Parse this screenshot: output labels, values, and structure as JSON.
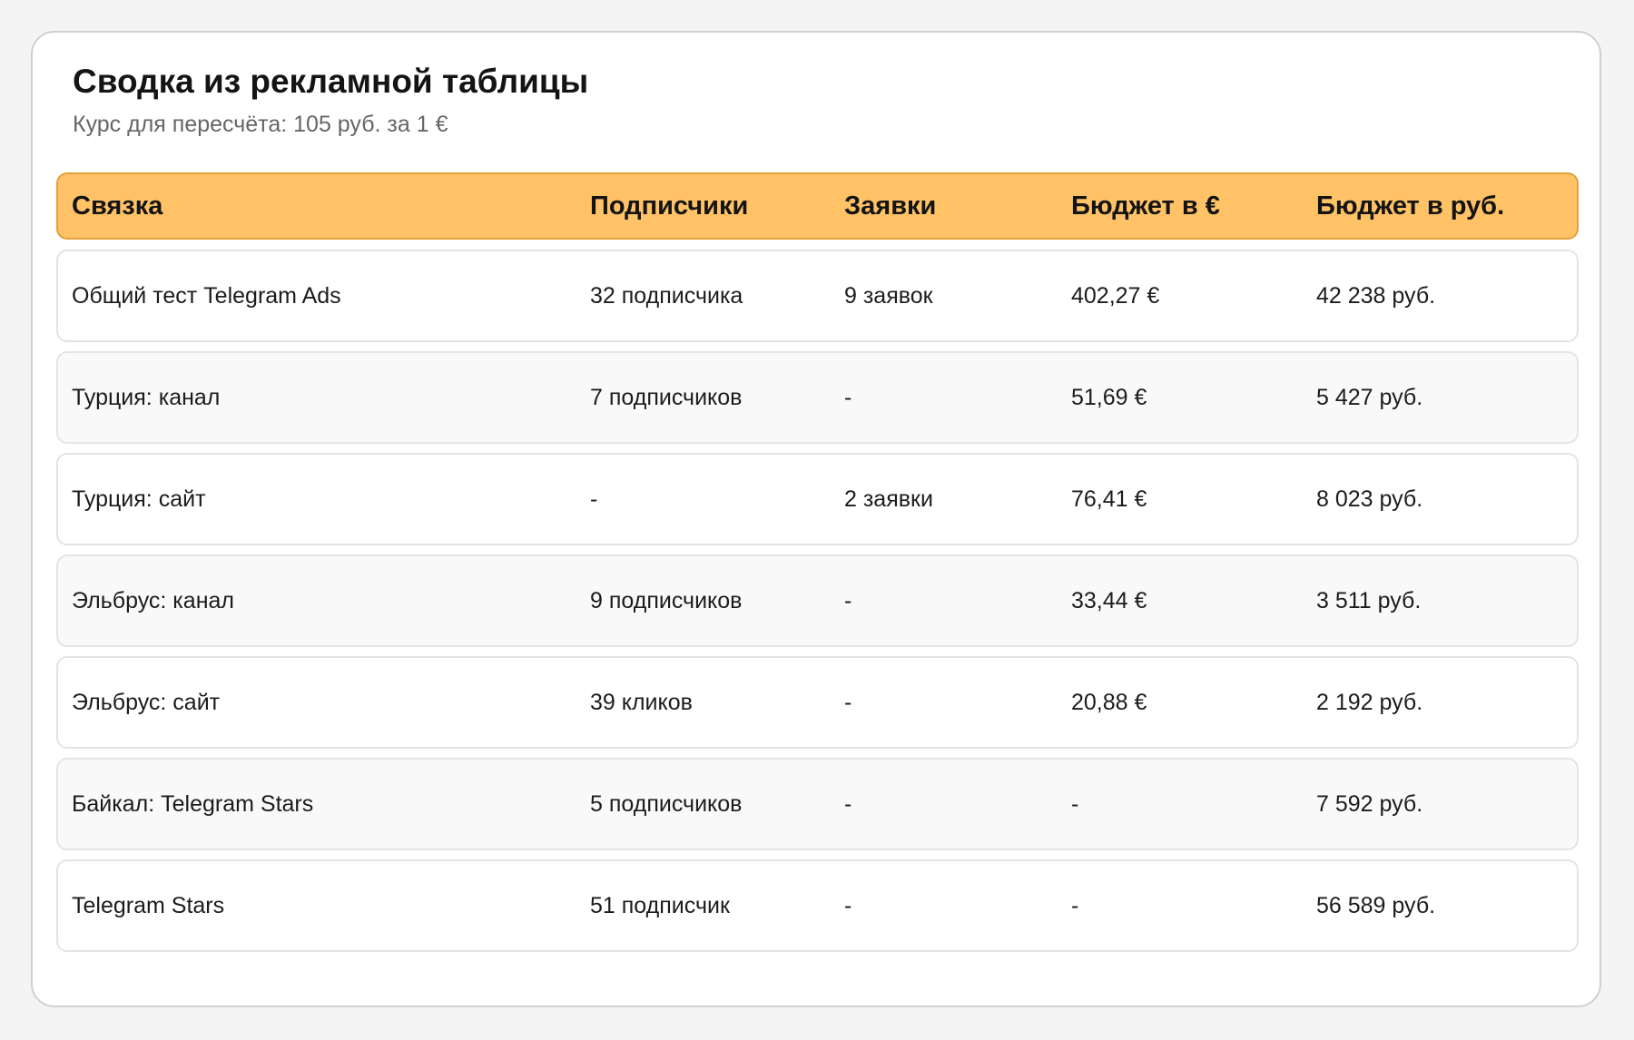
{
  "title": "Сводка из рекламной таблицы",
  "subtitle": "Курс для пересчёта: 105 руб. за 1 €",
  "table": {
    "headers": [
      "Связка",
      "Подписчики",
      "Заявки",
      "Бюджет в €",
      "Бюджет в руб."
    ],
    "rows": [
      [
        "Общий тест Telegram Ads",
        "32 подписчика",
        "9 заявок",
        "402,27 €",
        "42 238 руб."
      ],
      [
        "Турция: канал",
        "7 подписчиков",
        "-",
        "51,69 €",
        "5 427 руб."
      ],
      [
        "Турция: сайт",
        "-",
        "2 заявки",
        "76,41 €",
        "8 023 руб."
      ],
      [
        "Эльбрус: канал",
        "9 подписчиков",
        "-",
        "33,44 €",
        "3 511 руб."
      ],
      [
        "Эльбрус: сайт",
        "39 кликов",
        "-",
        "20,88 €",
        "2 192 руб."
      ],
      [
        "Байкал: Telegram Stars",
        "5 подписчиков",
        "-",
        "-",
        "7 592 руб."
      ],
      [
        "Telegram Stars",
        "51 подписчик",
        "-",
        "-",
        "56 589 руб."
      ]
    ]
  },
  "colors": {
    "header_background": "#ffc266",
    "header_border": "#e0a23c",
    "row_alt_background": "#f9f9f9"
  }
}
